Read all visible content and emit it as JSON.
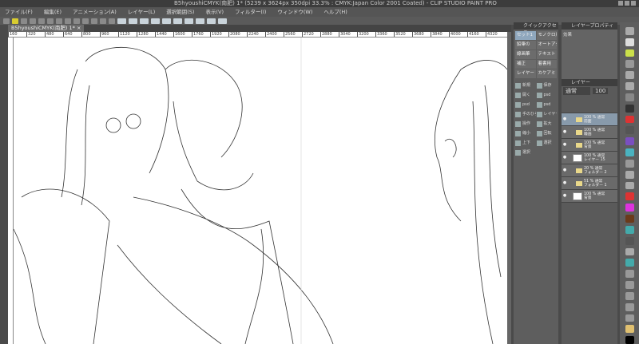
{
  "title": "B5hyoushiCMYK(南肥)  1* (5239 x 3624px 350dpi 33.3% : CMYK:Japan Color 2001 Coated) - CLIP STUDIO PAINT PRO",
  "menu": [
    "ファイル(F)",
    "編集(E)",
    "アニメーション(A)",
    "レイヤー(L)",
    "選択範囲(S)",
    "表示(V)",
    "フィルター(I)",
    "ウィンドウ(W)",
    "ヘルプ(H)"
  ],
  "doc_tab": "B5hyoushiCMYK(南肥)  1* ×",
  "ruler": [
    "160",
    "320",
    "480",
    "640",
    "800",
    "960",
    "1120",
    "1280",
    "1440",
    "1600",
    "1760",
    "1920",
    "2080",
    "2240",
    "2400",
    "2560",
    "2720",
    "2880",
    "3040",
    "3200",
    "3360",
    "3520",
    "3680",
    "3840",
    "4000",
    "4160",
    "4320"
  ],
  "quick": {
    "title": "クイックアクセス",
    "sets": [
      "セット1",
      "モノクロ用",
      "鉛筆の",
      "オートアク",
      "線画筆",
      "テキスト",
      "補正",
      "着書用",
      "レイヤー",
      "カケアミ"
    ],
    "commands": [
      "新規",
      "保存",
      "開く",
      "psd",
      "psd",
      "psd",
      "手のひら",
      "レイヤー",
      "操作",
      "拡大",
      "縮小",
      "回転",
      "上下",
      "選択",
      "選択"
    ]
  },
  "props": {
    "title": "レイヤープロパティ",
    "effect": "効果"
  },
  "layers": {
    "title": "レイヤー",
    "mode": "通常",
    "opacity": "100",
    "items": [
      {
        "info": "100 % 通常",
        "name": "前面",
        "type": "folder",
        "selected": true
      },
      {
        "info": "100 % 通常",
        "name": "瞳画",
        "type": "folder"
      },
      {
        "info": "100 % 通常",
        "name": "背景",
        "type": "folder"
      },
      {
        "info": "100 % 通常",
        "name": "レイヤー 15",
        "type": "layer"
      },
      {
        "info": "20 % 通常",
        "name": "フォルダー 2",
        "type": "folder"
      },
      {
        "info": "51 % 通常",
        "name": "フォルダー 1",
        "type": "folder"
      },
      {
        "info": "100 % 通常",
        "name": "背景",
        "type": "paper"
      }
    ]
  }
}
